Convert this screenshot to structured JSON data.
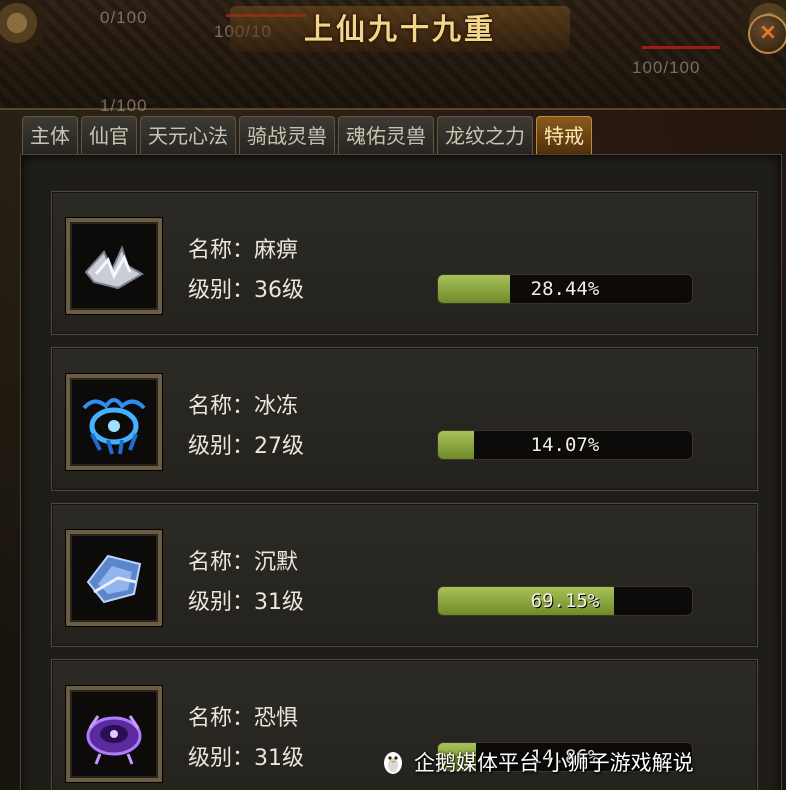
{
  "window": {
    "title": "上仙九十九重",
    "close_label": "×",
    "background_texts": [
      "0/100",
      "100/10",
      "100/100",
      "1/100"
    ]
  },
  "tabs": [
    {
      "label": "主体",
      "active": false
    },
    {
      "label": "仙官",
      "active": false
    },
    {
      "label": "天元心法",
      "active": false
    },
    {
      "label": "骑战灵兽",
      "active": false
    },
    {
      "label": "魂佑灵兽",
      "active": false
    },
    {
      "label": "龙纹之力",
      "active": false
    },
    {
      "label": "特戒",
      "active": true
    }
  ],
  "rings": [
    {
      "name_line": "名称：麻痹",
      "level_line": "级别：36级",
      "progress_text": "28.44%",
      "progress": 0.2844,
      "icon": "paralysis-ring-icon",
      "icon_color": "#d8dce2"
    },
    {
      "name_line": "名称：冰冻",
      "level_line": "级别：27级",
      "progress_text": "14.07%",
      "progress": 0.1407,
      "icon": "freeze-ring-icon",
      "icon_color": "#3aa8ff"
    },
    {
      "name_line": "名称：沉默",
      "level_line": "级别：31级",
      "progress_text": "69.15%",
      "progress": 0.6915,
      "icon": "silence-ring-icon",
      "icon_color": "#8fb8ff"
    },
    {
      "name_line": "名称：恐惧",
      "level_line": "级别：31级",
      "progress_text": "14.86%",
      "progress": 0.1486,
      "icon": "fear-ring-icon",
      "icon_color": "#9a5cff"
    }
  ],
  "watermark": {
    "text": "企鹅媒体平台 小狮子游戏解说",
    "icon": "penguin-icon"
  },
  "colors": {
    "bar_fill": "#8faa3e",
    "tab_active": "#8a5a1c",
    "title_gold": "#f2d58a"
  }
}
